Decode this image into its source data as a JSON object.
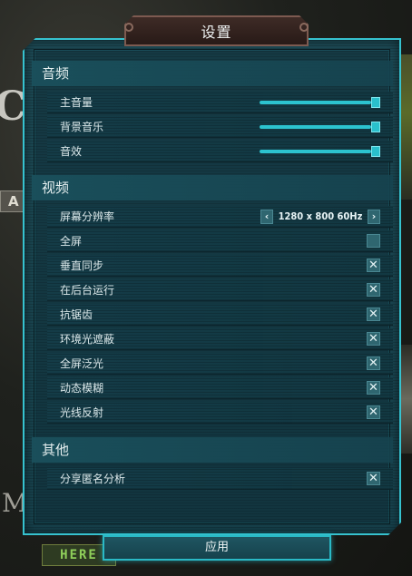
{
  "dialog": {
    "title": "设置",
    "apply_label": "应用"
  },
  "background": {
    "big_text": "C",
    "tag_text": "A",
    "lower_text": "M",
    "here_text": "HERE"
  },
  "sections": {
    "audio": {
      "title": "音频",
      "rows": [
        {
          "label": "主音量",
          "value": 1.0
        },
        {
          "label": "背景音乐",
          "value": 1.0
        },
        {
          "label": "音效",
          "value": 1.0
        }
      ]
    },
    "video": {
      "title": "视频",
      "resolution": {
        "label": "屏幕分辨率",
        "value": "1280 x 800 60Hz",
        "prev": "‹",
        "next": "›"
      },
      "toggles": [
        {
          "label": "全屏",
          "checked": false,
          "mark": ""
        },
        {
          "label": "垂直同步",
          "checked": true,
          "mark": "✕"
        },
        {
          "label": "在后台运行",
          "checked": true,
          "mark": "✕"
        },
        {
          "label": "抗锯齿",
          "checked": true,
          "mark": "✕"
        },
        {
          "label": "环境光遮蔽",
          "checked": true,
          "mark": "✕"
        },
        {
          "label": "全屏泛光",
          "checked": true,
          "mark": "✕"
        },
        {
          "label": "动态模糊",
          "checked": true,
          "mark": "✕"
        },
        {
          "label": "光线反射",
          "checked": true,
          "mark": "✕"
        }
      ]
    },
    "other": {
      "title": "其他",
      "toggles": [
        {
          "label": "分享匿名分析",
          "checked": true,
          "mark": "✕"
        }
      ]
    }
  },
  "colors": {
    "accent": "#36c2cf",
    "panel": "#1a4752",
    "title_tab": "#2f201c"
  }
}
